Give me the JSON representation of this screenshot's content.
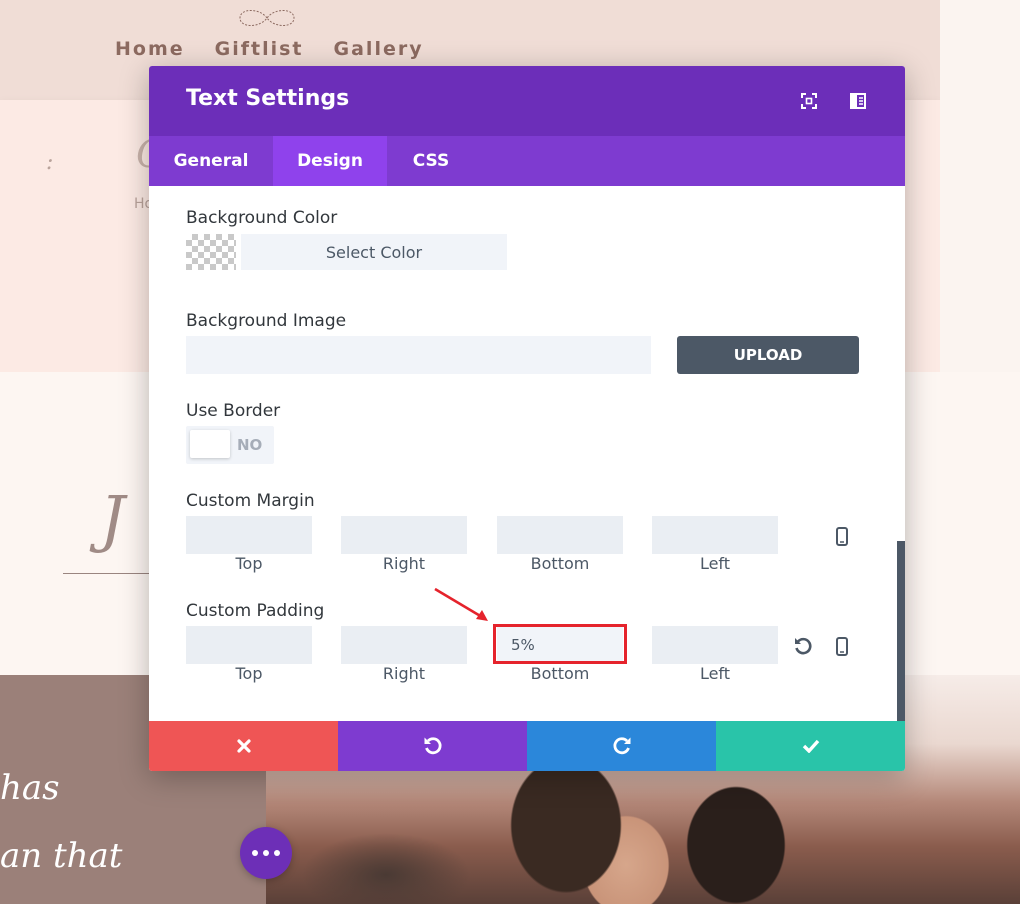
{
  "site": {
    "nav": [
      "Home",
      "Giftlist",
      "Gallery"
    ],
    "deco_colon": ":",
    "deco_c": "C",
    "deco_ho": "Ho",
    "deco_script": "J",
    "quote_line_1": "has",
    "quote_line_2": "an that"
  },
  "modal": {
    "title": "Text Settings",
    "tabs": [
      "General",
      "Design",
      "CSS"
    ],
    "active_tab": "Design",
    "background_color": {
      "label": "Background Color",
      "button": "Select Color"
    },
    "background_image": {
      "label": "Background Image",
      "value": "",
      "button": "UPLOAD"
    },
    "use_border": {
      "label": "Use Border",
      "value": "NO"
    },
    "custom_margin": {
      "label": "Custom Margin",
      "top": "",
      "right": "",
      "bottom": "",
      "left": "",
      "labels": [
        "Top",
        "Right",
        "Bottom",
        "Left"
      ]
    },
    "custom_padding": {
      "label": "Custom Padding",
      "top": "",
      "right": "",
      "bottom": "5%",
      "left": "",
      "labels": [
        "Top",
        "Right",
        "Bottom",
        "Left"
      ]
    }
  },
  "colors": {
    "modal_header": "#6c2eb9",
    "tabs_bar": "#7e3bd0",
    "active_tab": "#8f42ec",
    "cancel": "#ef5555",
    "undo": "#7e3bd0",
    "redo": "#2b87da",
    "save": "#29c4a9",
    "highlight": "#e5232c"
  },
  "icons": {
    "expand": "fullscreen-icon",
    "sidebar": "split-view-icon",
    "cancel": "close-icon",
    "undo": "undo-icon",
    "redo": "redo-icon",
    "save": "checkmark-icon",
    "reset": "reset-icon",
    "responsive": "phone-icon"
  }
}
